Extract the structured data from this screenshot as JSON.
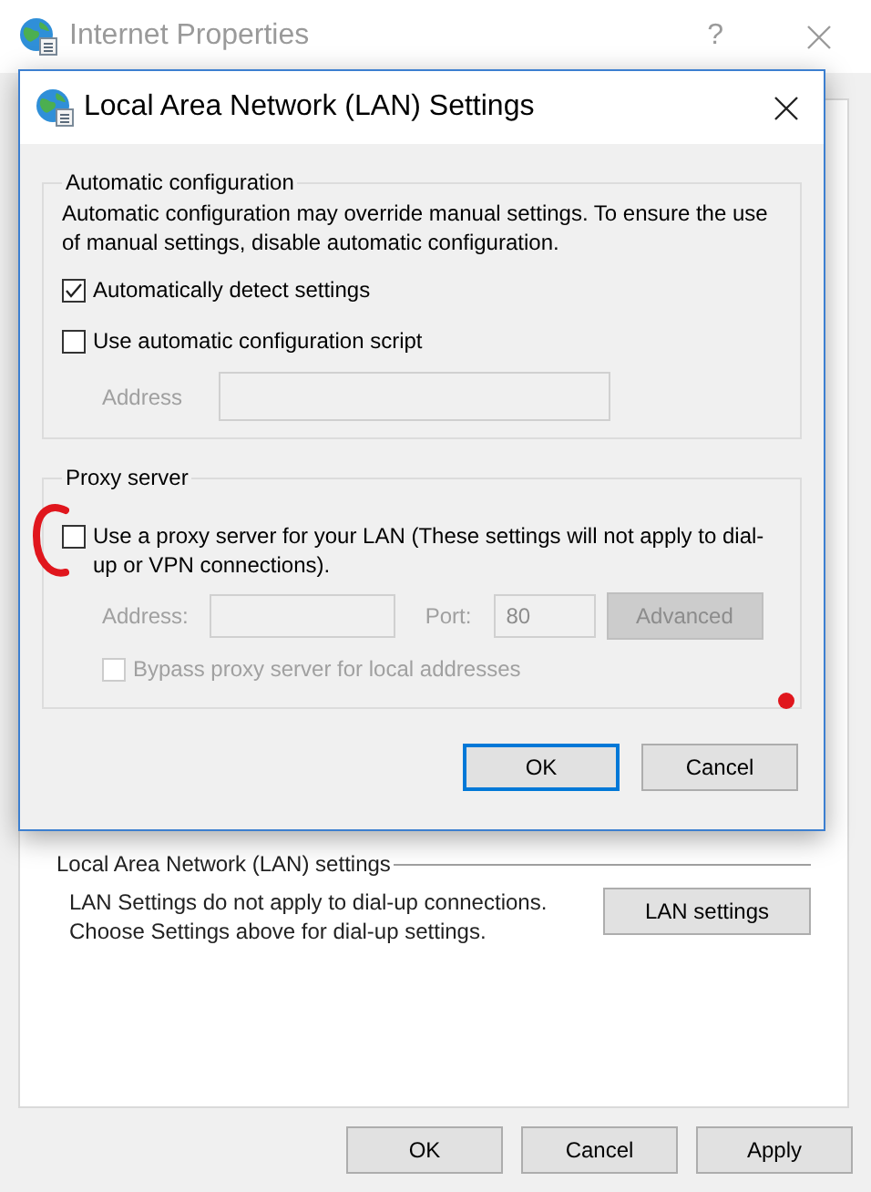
{
  "window": {
    "title": "Internet Properties",
    "help": "?"
  },
  "dialog": {
    "title": "Local Area Network (LAN) Settings",
    "automatic_configuration": {
      "legend": "Automatic configuration",
      "description": "Automatic configuration may override manual settings.  To ensure the use of manual settings, disable automatic configuration.",
      "options": [
        {
          "label": "Automatically detect settings",
          "checked": true
        },
        {
          "label": "Use automatic configuration script",
          "checked": false
        }
      ],
      "address": {
        "label": "Address",
        "disabled": true
      }
    },
    "proxy_server": {
      "legend": "Proxy server",
      "use_proxy": {
        "label": "Use a proxy server for your LAN (These settings will not apply to dial-up or VPN connections).",
        "checked": false
      },
      "disabled": true,
      "address_label": "Address:",
      "port_label": "Port:",
      "port_value": "80",
      "advanced_button": "Advanced",
      "bypass": {
        "label": "Bypass proxy server for local addresses",
        "checked": false
      }
    },
    "buttons": [
      {
        "label": "OK",
        "focused": true
      },
      {
        "label": "Cancel",
        "focused": false
      }
    ]
  },
  "lan_settings": {
    "legend": "Local Area Network (LAN) settings",
    "description": "LAN Settings do not apply to dial-up connections. Choose Settings above for dial-up settings.",
    "button": "LAN settings"
  },
  "buttons": [
    "OK",
    "Cancel",
    "Apply"
  ],
  "annotations": [
    {
      "kind": "circle"
    },
    {
      "kind": "dot"
    }
  ]
}
